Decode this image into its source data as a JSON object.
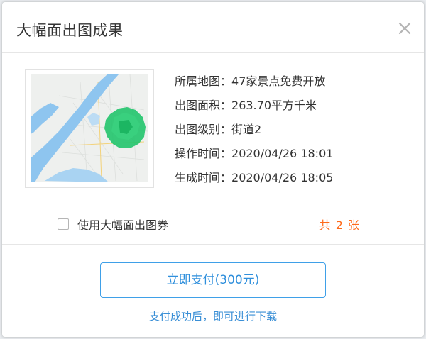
{
  "dialog": {
    "title": "大幅面出图成果",
    "close_icon": "close-icon"
  },
  "info": {
    "rows": [
      {
        "label": "所属地图：",
        "value": "47家景点免费开放"
      },
      {
        "label": "出图面积：",
        "value": "263.70平方千米"
      },
      {
        "label": "出图级别：",
        "value": "街道2"
      },
      {
        "label": "操作时间：",
        "value": "2020/04/26 18:01"
      },
      {
        "label": "生成时间：",
        "value": "2020/04/26 18:05"
      }
    ]
  },
  "voucher": {
    "label": "使用大幅面出图券",
    "checked": false,
    "count_text": "共 2 张"
  },
  "payment": {
    "button_label": "立即支付(300元)",
    "note": "支付成功后，即可进行下载"
  },
  "colors": {
    "accent_blue": "#3fa0e8",
    "count_orange": "#ff6a1a",
    "map_river": "#8ec5ef",
    "map_highlight": "#21c46b"
  }
}
